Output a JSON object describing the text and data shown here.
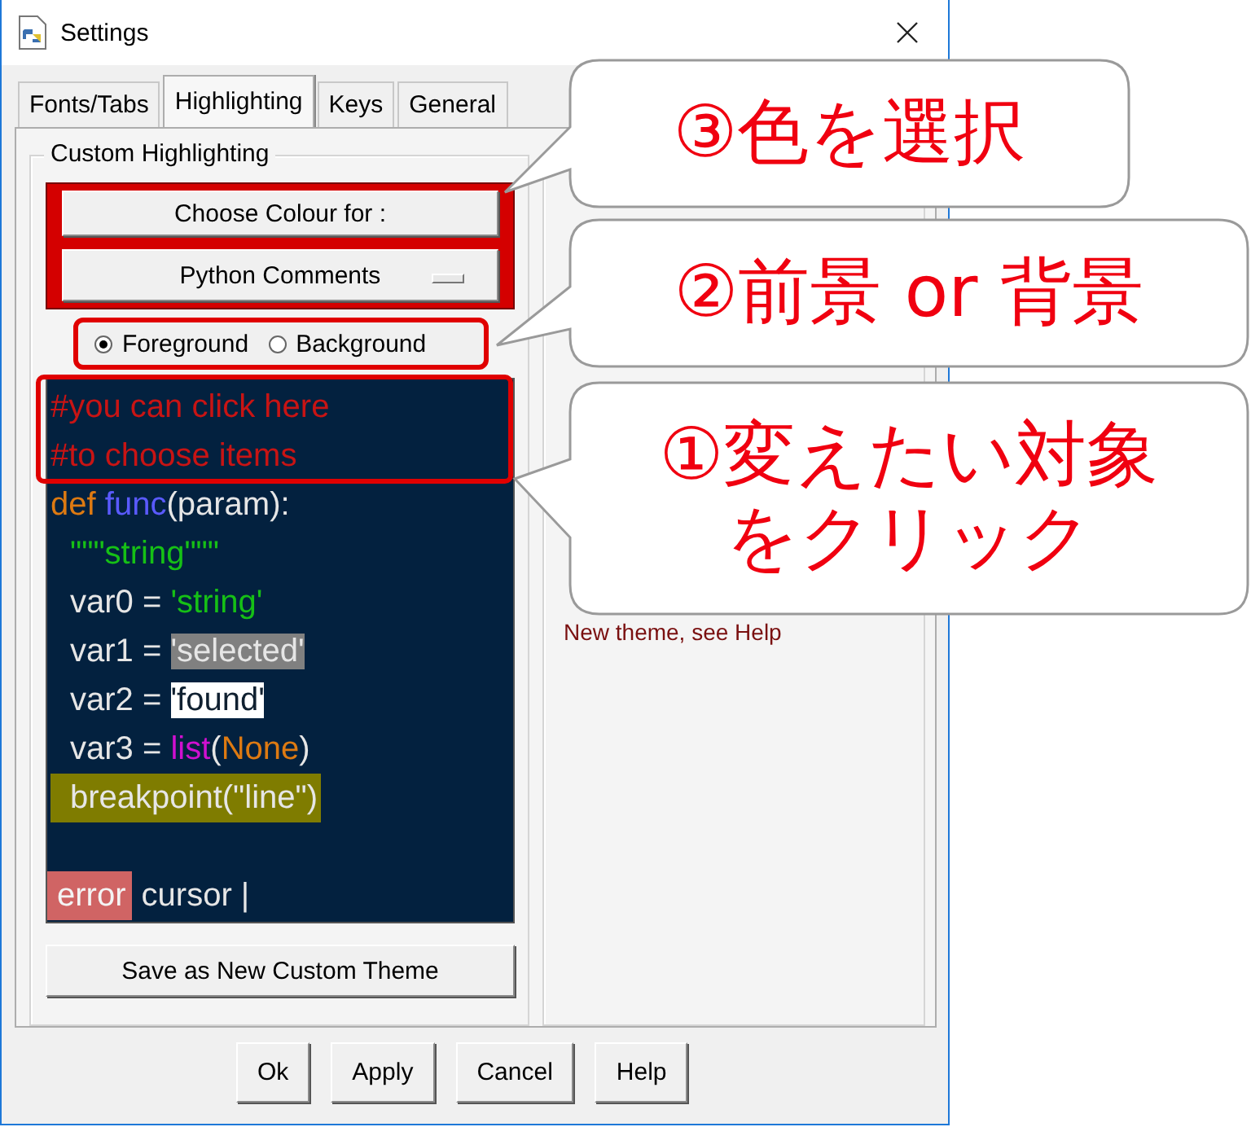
{
  "window": {
    "title": "Settings"
  },
  "tabs": [
    {
      "label": "Fonts/Tabs",
      "selected": false
    },
    {
      "label": "Highlighting",
      "selected": true
    },
    {
      "label": "Keys",
      "selected": false
    },
    {
      "label": "General",
      "selected": false
    }
  ],
  "custom_highlighting": {
    "title": "Custom Highlighting",
    "choose_button": "Choose Colour for :",
    "element_dropdown": "Python Comments",
    "radios": [
      {
        "label": "Foreground",
        "selected": true
      },
      {
        "label": "Background",
        "selected": false
      }
    ],
    "sample": [
      {
        "segments": [
          {
            "text": "#you can click here",
            "kind": "comment"
          }
        ]
      },
      {
        "segments": [
          {
            "text": "#to choose items",
            "kind": "comment"
          }
        ]
      },
      {
        "segments": [
          {
            "text": "def",
            "kind": "keyword"
          },
          {
            "text": "func",
            "kind": "definition"
          },
          {
            "text": "(param):",
            "kind": "normal"
          }
        ]
      },
      {
        "indent": true,
        "segments": [
          {
            "text": "\"\"\"string\"\"\"",
            "kind": "string"
          }
        ]
      },
      {
        "indent": true,
        "segments": [
          {
            "text": "var0 = ",
            "kind": "normal"
          },
          {
            "text": "'string'",
            "kind": "string"
          }
        ]
      },
      {
        "indent": true,
        "segments": [
          {
            "text": "var1 = ",
            "kind": "normal"
          },
          {
            "text": "'selected'",
            "kind": "selected"
          }
        ]
      },
      {
        "indent": true,
        "segments": [
          {
            "text": "var2 = ",
            "kind": "normal"
          },
          {
            "text": "'found'",
            "kind": "found"
          }
        ]
      },
      {
        "indent": true,
        "segments": [
          {
            "text": "var3 = ",
            "kind": "normal"
          },
          {
            "text": "list",
            "kind": "builtin"
          },
          {
            "text": "(",
            "kind": "normal"
          },
          {
            "text": "None",
            "kind": "keyword"
          },
          {
            "text": ")",
            "kind": "normal"
          }
        ]
      },
      {
        "indent": true,
        "breakpoint": true,
        "segments": [
          {
            "text": "breakpoint(\"line\")",
            "kind": "normal"
          }
        ]
      },
      {
        "kind": "blank"
      },
      {
        "segments": [
          {
            "text": "error",
            "kind": "error"
          },
          {
            "text": " cursor |",
            "kind": "normal"
          }
        ]
      }
    ],
    "save_button": "Save as New Custom Theme"
  },
  "theme_panel": {
    "note": "New theme, see Help"
  },
  "buttons": [
    "Ok",
    "Apply",
    "Cancel",
    "Help"
  ],
  "callouts": [
    {
      "lines": [
        "③色を選択"
      ]
    },
    {
      "lines": [
        "②前景 or 背景"
      ]
    },
    {
      "lines": [
        "①変えたい対象",
        "をクリック"
      ]
    }
  ]
}
